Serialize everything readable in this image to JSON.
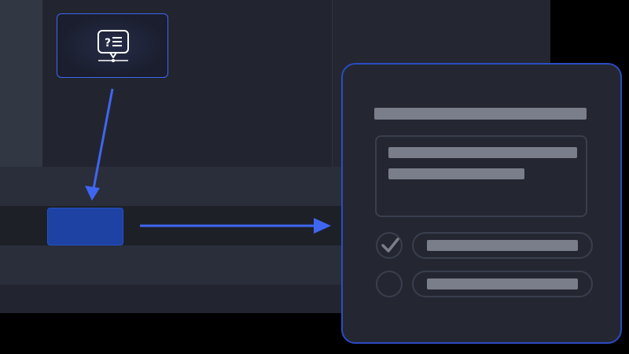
{
  "colors": {
    "accent": "#3f66f0",
    "selected_button": "#1d42a3",
    "dialog_border": "#2a4cc4",
    "placeholder_bar": "#7a7e8a",
    "check": "#7a7e8a"
  },
  "icons": {
    "hint": "speech-bubble-question-list-icon",
    "option_checked": "checkmark-icon",
    "option_unchecked": "empty-radio-icon",
    "arrow_down": "arrow-down-icon",
    "arrow_right": "arrow-right-icon"
  },
  "dialog": {
    "options": [
      {
        "checked": true
      },
      {
        "checked": false
      }
    ]
  }
}
